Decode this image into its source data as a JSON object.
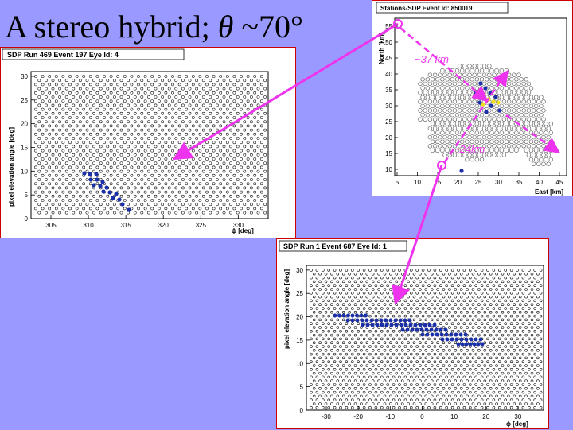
{
  "slide": {
    "title": "A stereo hybrid; ",
    "theta": "θ",
    "title_tail": " ~70°"
  },
  "colors": {
    "background": "#9999ff",
    "arrow": "#ee33ee",
    "pixel_hit": "#1a2fa8",
    "pixel_hit_yellow": "#f0e020",
    "frame_red": "#cc0000"
  },
  "panels": {
    "left": {
      "header": "SDP Run 469 Event 197 Eye Id: 4",
      "ylabel": "pixel elevation angle   [deg]",
      "xlabel": "ϕ  [deg]",
      "yticks": [
        "0",
        "5",
        "10",
        "15",
        "20",
        "25",
        "30"
      ],
      "xticks": [
        "305",
        "310",
        "315",
        "320",
        "325",
        "330"
      ]
    },
    "bottom": {
      "header": "SDP Run 1 Event 687 Eye Id: 1",
      "ylabel": "pixel elevation angle   [deg]",
      "xlabel": "ϕ  [deg]",
      "yticks": [
        "0",
        "5",
        "10",
        "15",
        "20",
        "25",
        "30"
      ],
      "xticks": [
        "-30",
        "-20",
        "-10",
        "0",
        "10",
        "20",
        "30"
      ]
    },
    "map": {
      "header": "Stations-SDP Event Id: 850019",
      "ylabel": "North [km]",
      "xlabel": "East   [km]",
      "yticks": [
        "10",
        "15",
        "20",
        "25",
        "30",
        "35",
        "40",
        "45",
        "50",
        "55"
      ],
      "xticks": [
        "5",
        "10",
        "15",
        "20",
        "25",
        "30",
        "35",
        "40",
        "45"
      ]
    }
  },
  "annotations": {
    "dist_37": "~37 km",
    "dist_24": "~24km"
  }
}
